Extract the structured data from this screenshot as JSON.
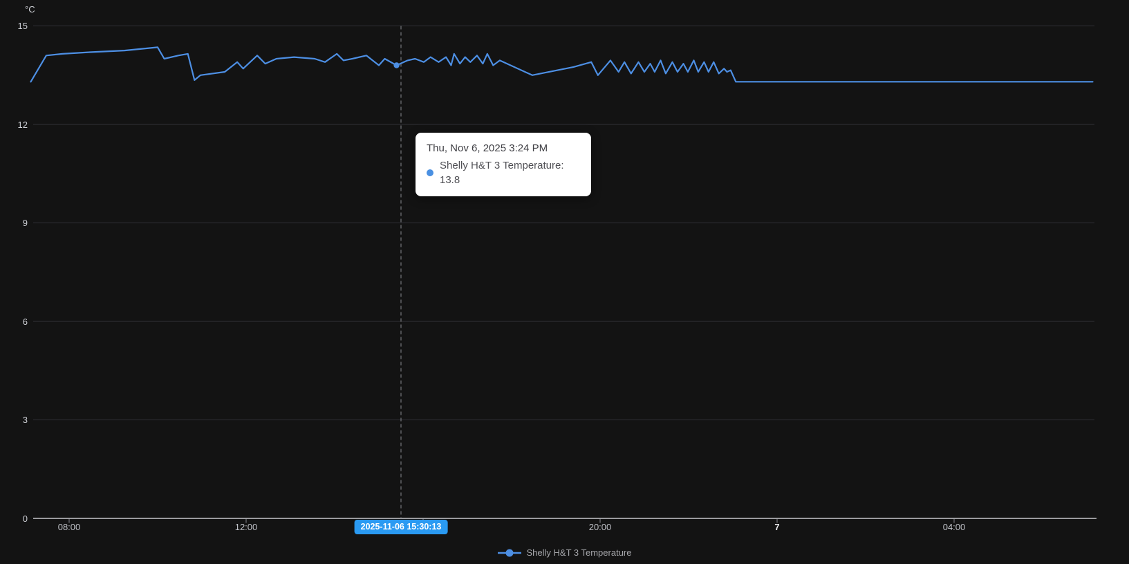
{
  "chart": {
    "unit_label": "°C",
    "selected_axis_label": "2025-11-06 15:30:13",
    "tooltip": {
      "title": "Thu, Nov 6, 2025 3:24 PM",
      "series_value_text": "Shelly H&T 3 Temperature: 13.8"
    },
    "legend": {
      "label": "Shelly H&T 3 Temperature"
    }
  },
  "colors": {
    "background": "#131313",
    "grid_line": "#303037",
    "axis_line": "#c7c8cd",
    "tick_mark": "#85868c",
    "crosshair": "#8a8b90",
    "series_line": "#4d8fe4",
    "selected_pill_bg": "#2a9af2",
    "selected_pill_text": "#ffffff",
    "tooltip_dot": "#4a90e2"
  },
  "chart_data": {
    "type": "line",
    "title": "",
    "ylabel": "°C",
    "ylim": [
      0,
      15
    ],
    "y_ticks": [
      0,
      3,
      6,
      9,
      12,
      15
    ],
    "grid": "horizontal-only",
    "legend_position": "bottom-center",
    "x_axis_note": "minutes since 2025-11-06 00:00",
    "x_ticks": [
      {
        "minutes": 480,
        "label": "08:00",
        "bold": false
      },
      {
        "minutes": 720,
        "label": "12:00",
        "bold": false
      },
      {
        "minutes": 960,
        "label": "",
        "bold": false
      },
      {
        "minutes": 1200,
        "label": "20:00",
        "bold": false
      },
      {
        "minutes": 1440,
        "label": "7",
        "bold": true
      },
      {
        "minutes": 1680,
        "label": "04:00",
        "bold": false
      }
    ],
    "crosshair_minutes": 930,
    "selected_point": {
      "minutes": 924,
      "value": 13.8
    },
    "series": [
      {
        "name": "Shelly H&T 3 Temperature",
        "color": "#4d8fe4",
        "points": [
          [
            428,
            13.3
          ],
          [
            449,
            14.1
          ],
          [
            471,
            14.15
          ],
          [
            508,
            14.2
          ],
          [
            555,
            14.25
          ],
          [
            600,
            14.35
          ],
          [
            609,
            14.0
          ],
          [
            628,
            14.1
          ],
          [
            641,
            14.15
          ],
          [
            650,
            13.35
          ],
          [
            658,
            13.5
          ],
          [
            691,
            13.6
          ],
          [
            708,
            13.9
          ],
          [
            716,
            13.7
          ],
          [
            735,
            14.1
          ],
          [
            746,
            13.85
          ],
          [
            761,
            14.0
          ],
          [
            785,
            14.05
          ],
          [
            813,
            14.0
          ],
          [
            827,
            13.9
          ],
          [
            843,
            14.15
          ],
          [
            852,
            13.95
          ],
          [
            864,
            14.0
          ],
          [
            883,
            14.1
          ],
          [
            900,
            13.8
          ],
          [
            908,
            14.0
          ],
          [
            924,
            13.8
          ],
          [
            939,
            13.95
          ],
          [
            949,
            14.0
          ],
          [
            961,
            13.9
          ],
          [
            970,
            14.05
          ],
          [
            981,
            13.9
          ],
          [
            991,
            14.05
          ],
          [
            998,
            13.8
          ],
          [
            1002,
            14.15
          ],
          [
            1010,
            13.85
          ],
          [
            1017,
            14.05
          ],
          [
            1024,
            13.9
          ],
          [
            1033,
            14.1
          ],
          [
            1041,
            13.85
          ],
          [
            1047,
            14.15
          ],
          [
            1055,
            13.8
          ],
          [
            1064,
            13.95
          ],
          [
            1108,
            13.5
          ],
          [
            1164,
            13.75
          ],
          [
            1188,
            13.9
          ],
          [
            1197,
            13.5
          ],
          [
            1214,
            13.95
          ],
          [
            1225,
            13.6
          ],
          [
            1233,
            13.9
          ],
          [
            1242,
            13.55
          ],
          [
            1252,
            13.9
          ],
          [
            1260,
            13.6
          ],
          [
            1268,
            13.85
          ],
          [
            1274,
            13.6
          ],
          [
            1282,
            13.95
          ],
          [
            1289,
            13.55
          ],
          [
            1298,
            13.9
          ],
          [
            1305,
            13.6
          ],
          [
            1313,
            13.85
          ],
          [
            1319,
            13.6
          ],
          [
            1327,
            13.95
          ],
          [
            1333,
            13.6
          ],
          [
            1341,
            13.9
          ],
          [
            1347,
            13.6
          ],
          [
            1354,
            13.9
          ],
          [
            1361,
            13.55
          ],
          [
            1368,
            13.7
          ],
          [
            1372,
            13.6
          ],
          [
            1377,
            13.65
          ],
          [
            1384,
            13.3
          ],
          [
            1868,
            13.3
          ]
        ]
      }
    ]
  }
}
